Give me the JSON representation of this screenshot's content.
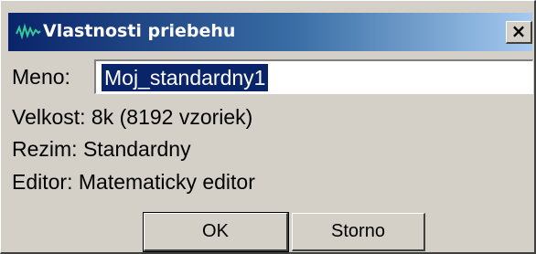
{
  "window": {
    "title": "Vlastnosti priebehu",
    "icon": "waveform-icon",
    "close_glyph": "×"
  },
  "form": {
    "name_label": "Meno:",
    "name_value": "Moj_standardny1",
    "size_text": "Velkost: 8k (8192 vzoriek)",
    "mode_text": "Rezim: Standardny",
    "editor_text": "Editor: Matematicky editor"
  },
  "buttons": {
    "ok_label": "OK",
    "cancel_label": "Storno"
  },
  "colors": {
    "titlebar_start": "#0a246a",
    "titlebar_end": "#a6caf0",
    "face": "#d4d0c8",
    "selection": "#0a246a",
    "waveform_icon": "#33cc99"
  }
}
